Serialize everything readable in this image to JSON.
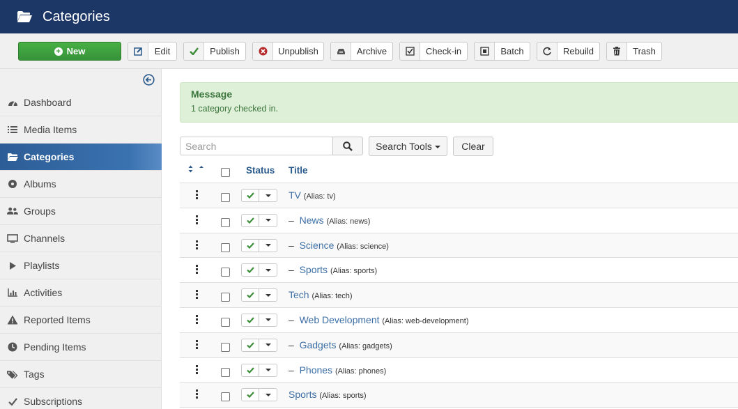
{
  "header": {
    "title": "Categories"
  },
  "toolbar": {
    "new_label": "New",
    "buttons": [
      "Edit",
      "Publish",
      "Unpublish",
      "Archive",
      "Check-in",
      "Batch",
      "Rebuild",
      "Trash"
    ]
  },
  "sidebar": {
    "items": [
      {
        "label": "Dashboard",
        "icon": "dashboard-icon"
      },
      {
        "label": "Media Items",
        "icon": "list-icon"
      },
      {
        "label": "Categories",
        "icon": "folder-icon",
        "active": true
      },
      {
        "label": "Albums",
        "icon": "disc-icon"
      },
      {
        "label": "Groups",
        "icon": "users-icon"
      },
      {
        "label": "Channels",
        "icon": "monitor-icon"
      },
      {
        "label": "Playlists",
        "icon": "play-icon"
      },
      {
        "label": "Activities",
        "icon": "bar-chart-icon"
      },
      {
        "label": "Reported Items",
        "icon": "warning-icon"
      },
      {
        "label": "Pending Items",
        "icon": "clock-icon"
      },
      {
        "label": "Tags",
        "icon": "tags-icon"
      },
      {
        "label": "Subscriptions",
        "icon": "check-icon"
      }
    ]
  },
  "message": {
    "heading": "Message",
    "text": "1 category checked in."
  },
  "search": {
    "placeholder": "Search",
    "tools_label": "Search Tools",
    "clear_label": "Clear"
  },
  "table": {
    "status_header": "Status",
    "title_header": "Title",
    "rows": [
      {
        "title": "TV",
        "alias": "(Alias: tv)",
        "prefix": ""
      },
      {
        "title": "News",
        "alias": "(Alias: news)",
        "prefix": "–"
      },
      {
        "title": "Science",
        "alias": "(Alias: science)",
        "prefix": "–"
      },
      {
        "title": "Sports",
        "alias": "(Alias: sports)",
        "prefix": "–"
      },
      {
        "title": "Tech",
        "alias": "(Alias: tech)",
        "prefix": ""
      },
      {
        "title": "Web Development",
        "alias": "(Alias: web-development)",
        "prefix": "–"
      },
      {
        "title": "Gadgets",
        "alias": "(Alias: gadgets)",
        "prefix": "–"
      },
      {
        "title": "Phones",
        "alias": "(Alias: phones)",
        "prefix": "–"
      },
      {
        "title": "Sports",
        "alias": "(Alias: sports)",
        "prefix": ""
      }
    ]
  },
  "colors": {
    "header_bg": "#1c3766",
    "new_button": "#3e9f3a",
    "active_nav": "#2d5d96",
    "message_bg": "#dff0d8",
    "link": "#3b6ea5"
  }
}
